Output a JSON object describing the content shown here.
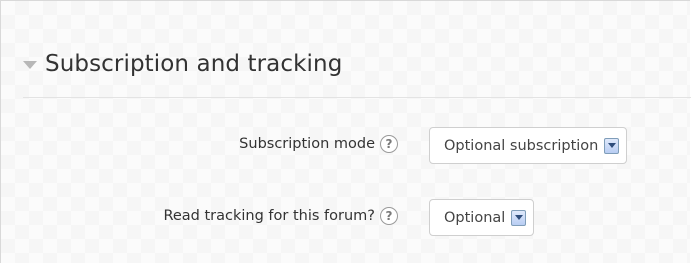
{
  "section": {
    "title": "Subscription and tracking",
    "icon": "collapse-triangle-icon"
  },
  "fields": [
    {
      "label": "Subscription mode",
      "help_glyph": "?",
      "help_icon": "help-icon",
      "selected": "Optional subscription"
    },
    {
      "label": "Read tracking for this forum?",
      "help_glyph": "?",
      "help_icon": "help-icon",
      "selected": "Optional"
    }
  ],
  "colors": {
    "text": "#333333",
    "select_text": "#444444",
    "dropdown_button": "#b8cdf3",
    "help_icon_border": "#9a9a9a"
  }
}
